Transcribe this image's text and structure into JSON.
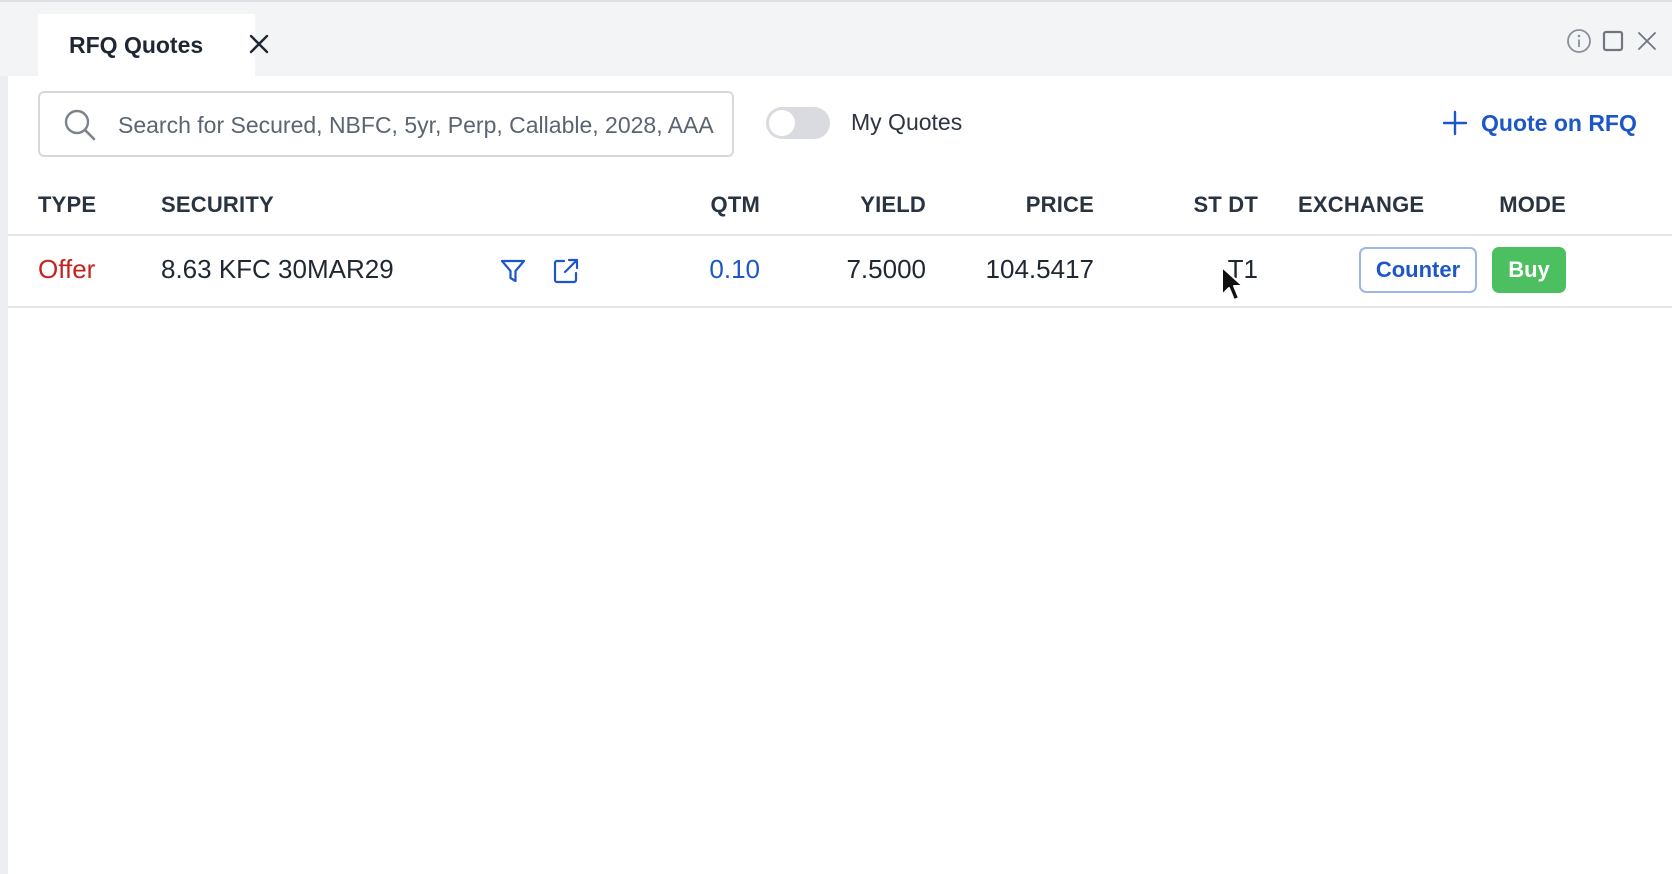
{
  "tab": {
    "title": "RFQ Quotes"
  },
  "toolbar": {
    "search_placeholder": "Search for Secured, NBFC, 5yr, Perp, Callable, 2028, AAA",
    "my_quotes_label": "My Quotes",
    "my_quotes_on": false,
    "quote_button_label": "Quote on RFQ"
  },
  "table": {
    "columns": [
      "TYPE",
      "SECURITY",
      "QTM",
      "YIELD",
      "PRICE",
      "ST DT",
      "EXCHANGE",
      "MODE"
    ],
    "rows": [
      {
        "type": "Offer",
        "security": "8.63 KFC 30MAR29",
        "qtm": "0.10",
        "yield": "7.5000",
        "price": "104.5417",
        "st_dt": "T1",
        "counter_label": "Counter",
        "buy_label": "Buy"
      }
    ]
  },
  "colors": {
    "accent": "#1d57c7",
    "offer": "#c6231f",
    "buy": "#4cbf60"
  },
  "icons": [
    "close-icon",
    "info-icon",
    "maximize-icon",
    "search-icon",
    "plus-icon",
    "filter-icon",
    "external-link-icon",
    "mouse-cursor"
  ]
}
